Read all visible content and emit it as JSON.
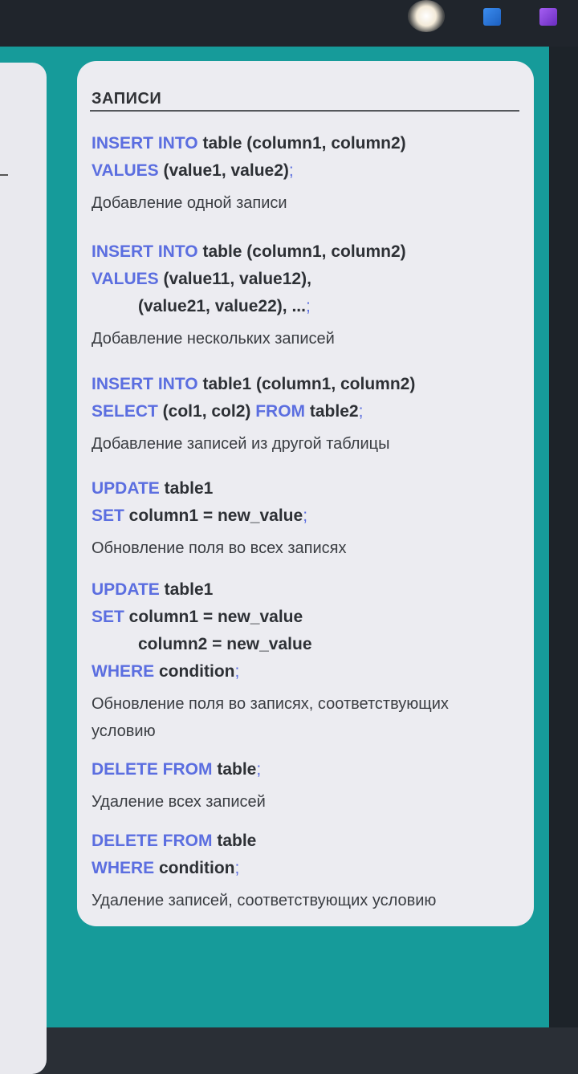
{
  "card": {
    "title": "ЗАПИСИ",
    "sections": [
      {
        "lines": [
          {
            "k1": "INSERT INTO",
            "t1": " table (column1, column2)"
          },
          {
            "k1": "VALUES",
            "t1": " (value1, value2)",
            "p": ";"
          }
        ],
        "description": "Добавление одной записи"
      },
      {
        "lines": [
          {
            "k1": "INSERT INTO",
            "t1": " table (column1, column2)"
          },
          {
            "k1": "VALUES",
            "t1": " (value11, value12),"
          },
          {
            "t1": "(value21, value22), ...",
            "p": ";"
          }
        ],
        "description": "Добавление нескольких записей"
      },
      {
        "lines": [
          {
            "k1": "INSERT INTO",
            "t1": " table1 (column1, column2)"
          },
          {
            "k1": "SELECT",
            "t1": " (col1, col2) ",
            "k2": "FROM",
            "t2": " table2",
            "p": ";"
          }
        ],
        "description": "Добавление записей из другой таблицы"
      },
      {
        "lines": [
          {
            "k1": "UPDATE",
            "t1": " table1"
          },
          {
            "k1": "SET",
            "t1": " column1 = new_value",
            "p": ";"
          }
        ],
        "description": "Обновление поля во всех записях"
      },
      {
        "lines": [
          {
            "k1": "UPDATE",
            "t1": " table1"
          },
          {
            "k1": "SET",
            "t1": " column1 = new_value"
          },
          {
            "t1": "column2 = new_value"
          },
          {
            "k1": "WHERE",
            "t1": " condition",
            "p": ";"
          }
        ],
        "description": "Обновление поля во записях, соответствующих условию"
      },
      {
        "lines": [
          {
            "k1": "DELETE FROM",
            "t1": " table",
            "p": ";"
          }
        ],
        "description": "Удаление всех записей"
      },
      {
        "lines": [
          {
            "k1": "DELETE FROM",
            "t1": " table"
          },
          {
            "k1": "WHERE",
            "t1": " condition",
            "p": ";"
          }
        ],
        "description": "Удаление записей, соответствующих условию"
      }
    ]
  },
  "colors": {
    "keyword": "#5b6ee0",
    "teal_background": "#169b9a",
    "card_background": "#ececf1"
  },
  "icons": {
    "tray_left": "blue-app-icon",
    "tray_right": "purple-app-icon"
  }
}
